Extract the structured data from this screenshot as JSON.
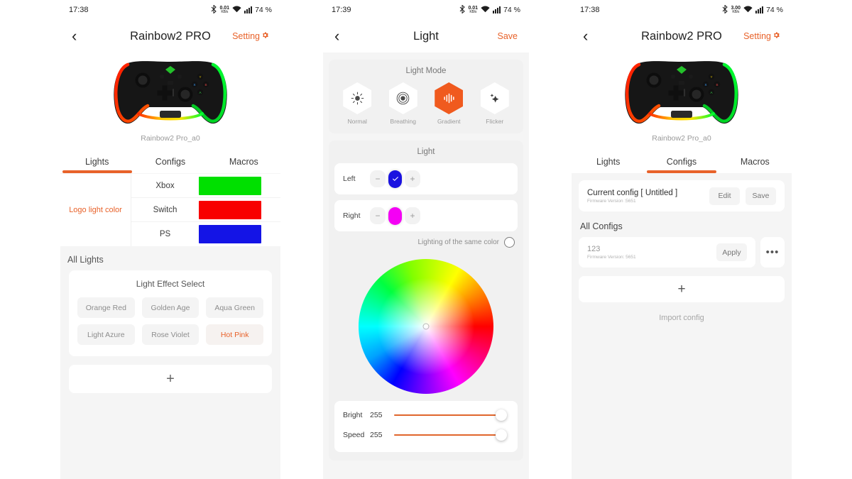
{
  "accent": "#e8622a",
  "screens": [
    {
      "status": {
        "time": "17:38",
        "net_speed": "0.01",
        "net_unit": "KB/s",
        "battery": "74 %",
        "icons": [
          "bluetooth-icon",
          "network-speed-icon",
          "wifi-icon",
          "signal-icon",
          "battery-icon"
        ]
      },
      "nav": {
        "back": "‹",
        "title": "Rainbow2 PRO",
        "action": "Setting",
        "action_icon": "gear-icon"
      },
      "device": {
        "name": "Rainbow2 Pro_a0"
      },
      "tabs": [
        {
          "label": "Lights",
          "active": true
        },
        {
          "label": "Configs",
          "active": false
        },
        {
          "label": "Macros",
          "active": false
        }
      ],
      "logo_section": {
        "label": "Logo light color",
        "rows": [
          {
            "name": "Xbox",
            "color": "#00e000"
          },
          {
            "name": "Switch",
            "color": "#f80000"
          },
          {
            "name": "PS",
            "color": "#1414e6"
          }
        ]
      },
      "all_lights": {
        "title": "All Lights",
        "effect_title": "Light Effect Select",
        "effects": [
          {
            "label": "Orange Red",
            "active": false
          },
          {
            "label": "Golden Age",
            "active": false
          },
          {
            "label": "Aqua Green",
            "active": false
          },
          {
            "label": "Light Azure",
            "active": false
          },
          {
            "label": "Rose Violet",
            "active": false
          },
          {
            "label": "Hot Pink",
            "active": true
          }
        ],
        "add_label": "+"
      }
    },
    {
      "status": {
        "time": "17:39",
        "net_speed": "0.01",
        "net_unit": "KB/s",
        "battery": "74 %",
        "icons": [
          "bluetooth-icon",
          "network-speed-icon",
          "wifi-icon",
          "signal-icon",
          "battery-icon"
        ]
      },
      "nav": {
        "back": "‹",
        "title": "Light",
        "action": "Save"
      },
      "light_mode": {
        "title": "Light Mode",
        "modes": [
          {
            "label": "Normal",
            "icon": "sun-icon",
            "active": false
          },
          {
            "label": "Breathing",
            "icon": "circles-icon",
            "active": false
          },
          {
            "label": "Gradient",
            "icon": "waveform-icon",
            "active": true
          },
          {
            "label": "Flicker",
            "icon": "sparkles-icon",
            "active": false
          }
        ]
      },
      "light": {
        "title": "Light",
        "channels": [
          {
            "label": "Left",
            "minus": "−",
            "plus": "+",
            "color": "#1a12e0",
            "checked": true
          },
          {
            "label": "Right",
            "minus": "−",
            "plus": "+",
            "color": "#f400f4",
            "checked": false
          }
        ],
        "same_color_label": "Lighting of the same color",
        "same_color_on": false
      },
      "sliders": [
        {
          "label": "Bright",
          "value": "255",
          "percent": 100
        },
        {
          "label": "Speed",
          "value": "255",
          "percent": 100
        }
      ]
    },
    {
      "status": {
        "time": "17:38",
        "net_speed": "3.00",
        "net_unit": "KB/s",
        "battery": "74 %",
        "icons": [
          "bluetooth-icon",
          "network-speed-icon",
          "wifi-icon",
          "signal-icon",
          "battery-icon"
        ]
      },
      "nav": {
        "back": "‹",
        "title": "Rainbow2 PRO",
        "action": "Setting",
        "action_icon": "gear-icon"
      },
      "device": {
        "name": "Rainbow2 Pro_a0"
      },
      "tabs": [
        {
          "label": "Lights",
          "active": false
        },
        {
          "label": "Configs",
          "active": true
        },
        {
          "label": "Macros",
          "active": false
        }
      ],
      "configs": {
        "current_title": "Current config [ Untitled ]",
        "current_fw": "Firmware Version :5651",
        "edit_label": "Edit",
        "save_label": "Save",
        "all_title": "All Configs",
        "rows": [
          {
            "name": "123",
            "fw": "Firmware Version: 5651",
            "apply_label": "Apply",
            "more": "•••"
          }
        ],
        "add_label": "+",
        "import_label": "Import config"
      }
    }
  ]
}
